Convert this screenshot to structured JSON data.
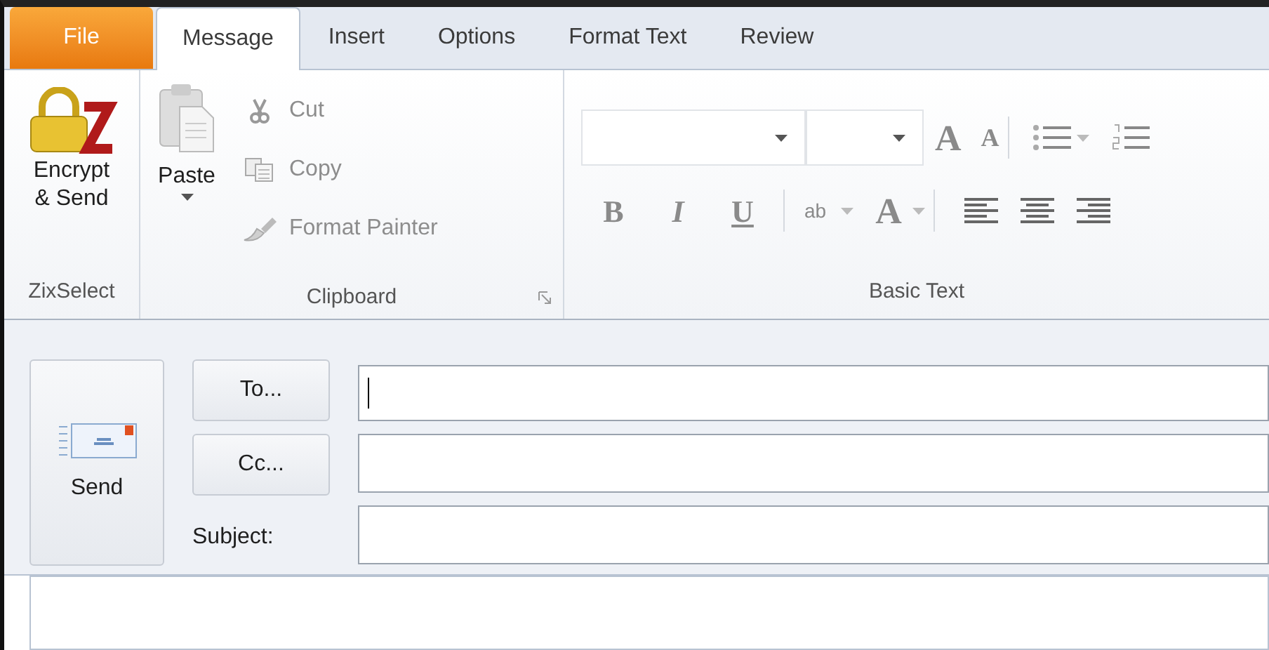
{
  "tabs": [
    {
      "label": "File",
      "kind": "file",
      "selected": false
    },
    {
      "label": "Message",
      "kind": "tab",
      "selected": true
    },
    {
      "label": "Insert",
      "kind": "tab",
      "selected": false
    },
    {
      "label": "Options",
      "kind": "tab",
      "selected": false
    },
    {
      "label": "Format Text",
      "kind": "tab",
      "selected": false
    },
    {
      "label": "Review",
      "kind": "tab",
      "selected": false
    }
  ],
  "zix_group": {
    "label": "ZixSelect",
    "button": {
      "label_lines": [
        "Encrypt",
        "& Send"
      ]
    }
  },
  "clipboard_group": {
    "label": "Clipboard",
    "paste": {
      "label": "Paste"
    },
    "items": [
      {
        "label": "Cut",
        "kind": "cut",
        "disabled": true
      },
      {
        "label": "Copy",
        "kind": "copy",
        "disabled": true
      },
      {
        "label": "Format Painter",
        "kind": "painter",
        "disabled": true
      }
    ]
  },
  "basic_text_group": {
    "label": "Basic Text",
    "disabled": true,
    "grow_glyph": "A",
    "shrink_glyph": "A",
    "format_buttons": [
      {
        "glyph": "B",
        "kind": "bold"
      },
      {
        "glyph": "I",
        "kind": "italic"
      },
      {
        "glyph": "U",
        "kind": "underline"
      }
    ],
    "highlight_glyph": "ab",
    "font_color_glyph": "A"
  },
  "compose": {
    "send_label": "Send",
    "to_label": "To...",
    "cc_label": "Cc...",
    "subject_label": "Subject:",
    "to_focused": true
  }
}
